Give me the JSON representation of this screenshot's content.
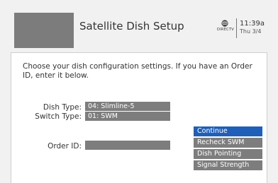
{
  "header": {
    "title": "Satellite Dish Setup",
    "logo_text": "DIRECTV",
    "time": "11:39a",
    "date": "Thu 3/4"
  },
  "instructions": "Choose your dish configuration settings. If you have an Order ID, enter it below.",
  "settings": {
    "dish_type_label": "Dish Type:",
    "dish_type_value": "04: Slimline-5",
    "switch_type_label": "Switch Type:",
    "switch_type_value": "01: SWM",
    "order_id_label": "Order ID:",
    "order_id_value": ""
  },
  "menu": {
    "items": [
      {
        "label": "Continue"
      },
      {
        "label": "Recheck SWM"
      },
      {
        "label": "Dish Pointing"
      },
      {
        "label": "Signal Strength"
      }
    ],
    "selected": "Continue"
  },
  "colors": {
    "selected_menu": "#1f5fb8",
    "field_bg": "#7d7d7d",
    "thumbnail": "#7c7c7c"
  }
}
